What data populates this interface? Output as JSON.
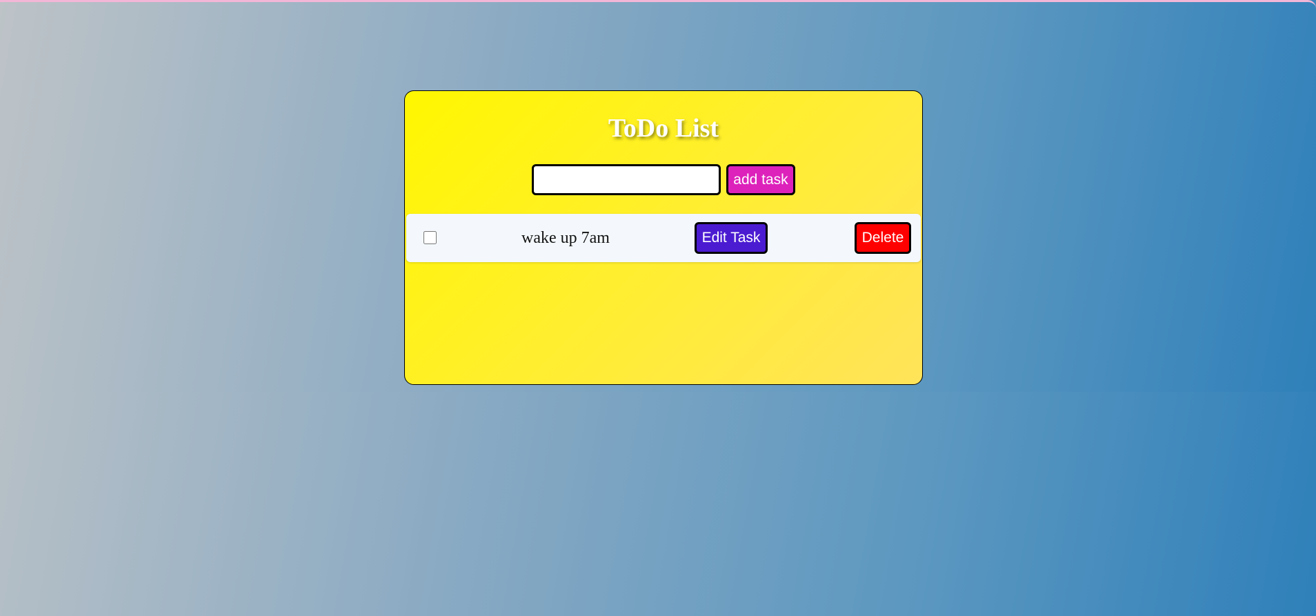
{
  "app": {
    "title": "ToDo List"
  },
  "new_task": {
    "value": "",
    "placeholder": "",
    "add_label": "add task"
  },
  "tasks": [
    {
      "text": "wake up 7am",
      "checked": false,
      "edit_label": "Edit Task",
      "delete_label": "Delete"
    }
  ],
  "colors": {
    "card_gradient_start": "#fff700",
    "card_gradient_end": "#ffe35a",
    "add_button": "#dd22bb",
    "edit_button": "#4b1bd1",
    "delete_button": "#ff0000",
    "page_gradient_start": "#bdc3c7",
    "page_gradient_end": "#2f80ba"
  }
}
